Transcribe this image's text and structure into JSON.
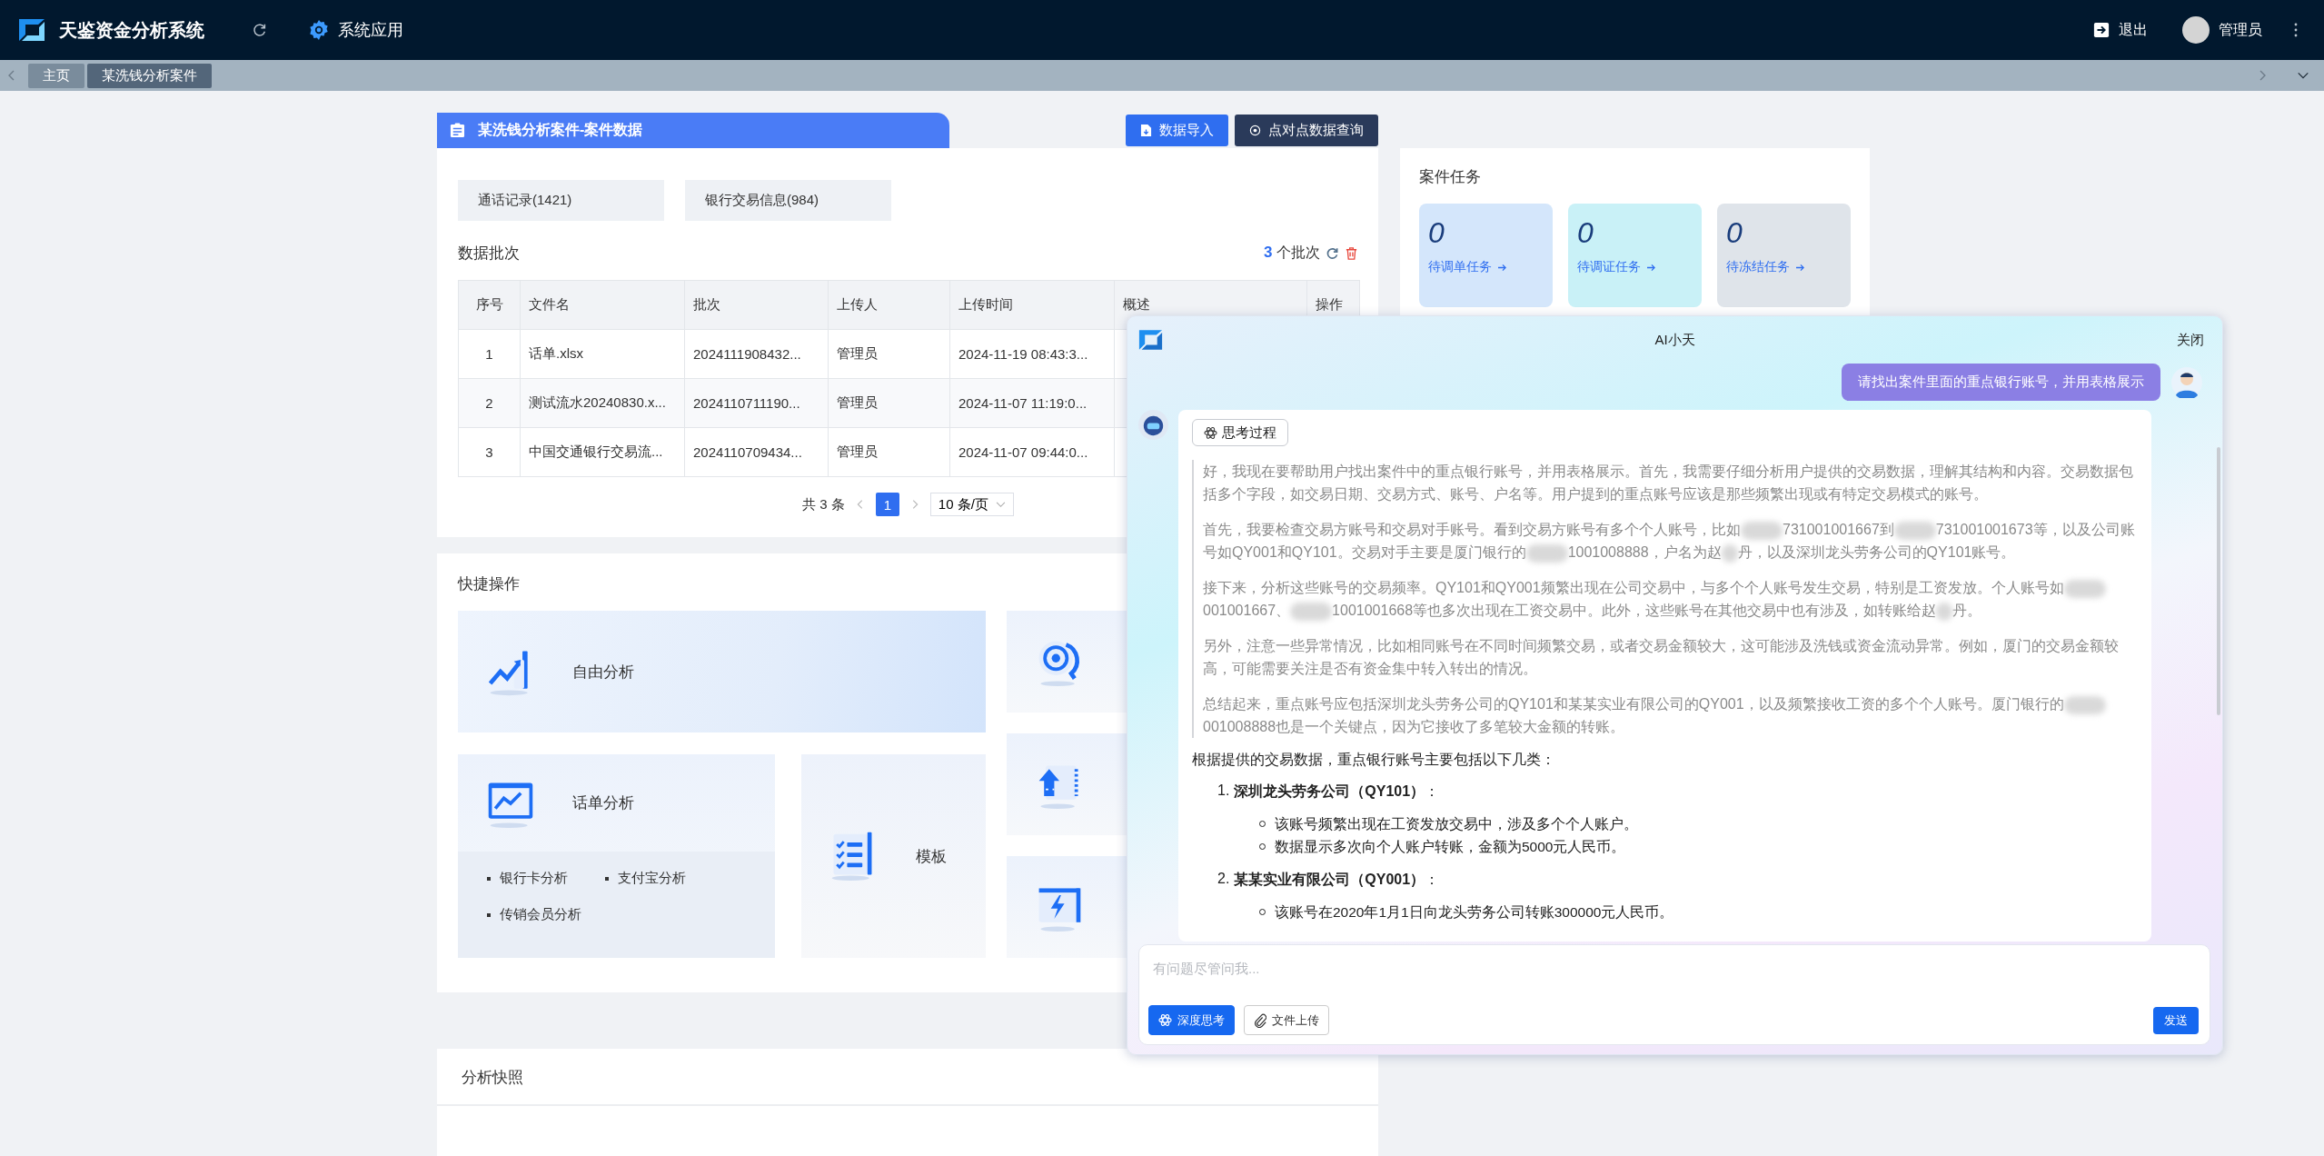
{
  "app": {
    "title": "天鉴资金分析系统",
    "menu": "系统应用",
    "logout": "退出",
    "user": "管理员"
  },
  "tabs": [
    {
      "label": "主页",
      "selected": false
    },
    {
      "label": "某洗钱分析案件",
      "selected": true
    }
  ],
  "case_panel": {
    "title": "某洗钱分析案件-案件数据",
    "actions": [
      {
        "label": "数据导入",
        "kind": "import"
      },
      {
        "label": "点对点数据查询",
        "kind": "query"
      }
    ],
    "sources": [
      "通话记录(1421)",
      "银行交易信息(984)"
    ],
    "batches": {
      "title": "数据批次",
      "count": "3",
      "unit": "个批次"
    },
    "table": {
      "columns": [
        "序号",
        "文件名",
        "批次",
        "上传人",
        "上传时间",
        "概述",
        "操作"
      ],
      "rows": [
        [
          "1",
          "话单.xlsx",
          "2024111908432...",
          "管理员",
          "2024-11-19 08:43:3..."
        ],
        [
          "2",
          "测试流水20240830.x...",
          "2024110711190...",
          "管理员",
          "2024-11-07 11:19:0..."
        ],
        [
          "3",
          "中国交通银行交易流...",
          "2024110709434...",
          "管理员",
          "2024-11-07 09:44:0..."
        ]
      ]
    },
    "pagination": {
      "total": "共 3 条",
      "pages": [
        {
          "label": "1",
          "selected": true
        }
      ],
      "page_size": "10 条/页"
    }
  },
  "quick_actions": {
    "title": "快捷操作",
    "cards": [
      {
        "label": "自由分析",
        "kind": "wide"
      },
      {
        "label": "话单分析",
        "kind": "list",
        "items": [
          "银行卡分析",
          "支付宝分析",
          "传销会员分析"
        ]
      },
      {
        "label": "模板",
        "kind": "tall"
      }
    ]
  },
  "snapshot": {
    "title": "分析快照"
  },
  "case_tasks": {
    "title": "案件任务",
    "tasks": [
      {
        "count": "0",
        "label": "待调单任务",
        "color": "#d4e6fb"
      },
      {
        "count": "0",
        "label": "待调证任务",
        "color": "#c9f1f7"
      },
      {
        "count": "0",
        "label": "待冻结任务",
        "color": "#dfe4ea"
      }
    ]
  },
  "assistant": {
    "title": "AI小天",
    "close": "关闭",
    "question": "请找出案件里面的重点银行账号，并用表格展示",
    "thinking_label": "思考过程",
    "thinking": [
      [
        {
          "kind": "text",
          "text": "好，我现在要帮助用户找出案件中的重点银行账号，并用表格展示。首先，我需要仔细分析用户提供的交易数据，理解其结构和内容。交易数据包括多个字段，如交易日期、交易方式、账号、户名等。用户提到的重点账号应该是那些频繁出现或有特定交易模式的账号。"
        }
      ],
      [
        {
          "kind": "text",
          "text": "首先，我要检查交易方账号和交易对手账号。看到交易方账号有多个个人账号，比如"
        },
        {
          "kind": "blur"
        },
        {
          "kind": "text",
          "text": "731001001667到"
        },
        {
          "kind": "blur"
        },
        {
          "kind": "text",
          "text": "731001001673等，以及公司账号如QY001和QY101。交易对手主要是厦门银行的"
        },
        {
          "kind": "blur"
        },
        {
          "kind": "text",
          "text": "1001008888，户名为赵"
        },
        {
          "kind": "blur_small"
        },
        {
          "kind": "text",
          "text": "丹，以及深圳龙头劳务公司的QY101账号。"
        }
      ],
      [
        {
          "kind": "text",
          "text": "接下来，分析这些账号的交易频率。QY101和QY001频繁出现在公司交易中，与多个个人账号发生交易，特别是工资发放。个人账号如"
        },
        {
          "kind": "blur"
        },
        {
          "kind": "text",
          "text": "001001667、"
        },
        {
          "kind": "blur"
        },
        {
          "kind": "text",
          "text": "1001001668等也多次出现在工资交易中。此外，这些账号在其他交易中也有涉及，如转账给赵"
        },
        {
          "kind": "blur_small"
        },
        {
          "kind": "text",
          "text": "丹。"
        }
      ],
      [
        {
          "kind": "text",
          "text": "另外，注意一些异常情况，比如相同账号在不同时间频繁交易，或者交易金额较大，这可能涉及洗钱或资金流动异常。例如，厦门的交易金额较高，可能需要关注是否有资金集中转入转出的情况。"
        }
      ],
      [
        {
          "kind": "text",
          "text": "总结起来，重点账号应包括深圳龙头劳务公司的QY101和某某实业有限公司的QY001，以及频繁接收工资的多个个人账号。厦门银行的"
        },
        {
          "kind": "blur"
        },
        {
          "kind": "text",
          "text": "001008888也是一个关键点，因为它接收了多笔较大金额的转账。"
        }
      ]
    ],
    "answer_intro": "根据提供的交易数据，重点银行账号主要包括以下几类：",
    "answer": [
      {
        "number": "1.",
        "title": "**深圳龙头劳务公司（QY101）**：",
        "points": [
          "该账号频繁出现在工资发放交易中，涉及多个个人账户。",
          "数据显示多次向个人账户转账，金额为5000元人民币。"
        ]
      },
      {
        "number": "2.",
        "title": "**某某实业有限公司（QY001）**：",
        "points": [
          "该账号在2020年1月1日向龙头劳务公司转账300000元人民币。"
        ]
      }
    ],
    "placeholder": "有问题尽管问我...",
    "deep_think": {
      "label": "深度思考",
      "on": true
    },
    "upload": "文件上传",
    "send": "发送"
  }
}
